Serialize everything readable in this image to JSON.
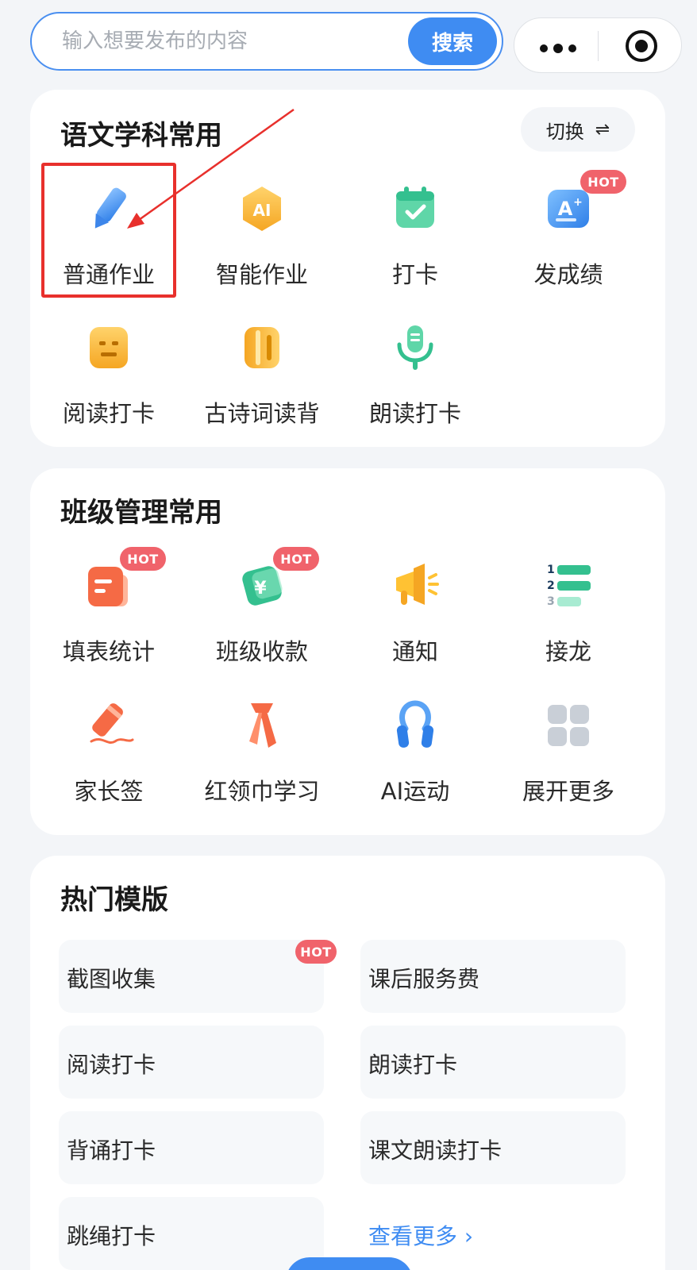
{
  "search": {
    "placeholder": "输入想要发布的内容",
    "button_label": "搜索"
  },
  "subject_section": {
    "title": "语文学科常用",
    "switch_label": "切换",
    "items": [
      {
        "label": "普通作业",
        "icon": "pencil-icon"
      },
      {
        "label": "智能作业",
        "icon": "ai-icon"
      },
      {
        "label": "打卡",
        "icon": "calendar-check-icon"
      },
      {
        "label": "发成绩",
        "icon": "grade-icon",
        "badge": "HOT"
      },
      {
        "label": "阅读打卡",
        "icon": "reading-icon"
      },
      {
        "label": "古诗词读背",
        "icon": "scroll-icon"
      },
      {
        "label": "朗读打卡",
        "icon": "microphone-icon"
      }
    ]
  },
  "class_section": {
    "title": "班级管理常用",
    "items": [
      {
        "label": "填表统计",
        "icon": "form-icon",
        "badge": "HOT"
      },
      {
        "label": "班级收款",
        "icon": "payment-icon",
        "badge": "HOT"
      },
      {
        "label": "通知",
        "icon": "megaphone-icon"
      },
      {
        "label": "接龙",
        "icon": "numbered-list-icon",
        "list_numbers": [
          "1",
          "2",
          "3"
        ]
      },
      {
        "label": "家长签",
        "icon": "signature-icon"
      },
      {
        "label": "红领巾学习",
        "icon": "red-scarf-icon"
      },
      {
        "label": "AI运动",
        "icon": "hand-grip-icon"
      },
      {
        "label": "展开更多",
        "icon": "grid-more-icon"
      }
    ]
  },
  "template_section": {
    "title": "热门模版",
    "items": [
      {
        "label": "截图收集",
        "badge": "HOT"
      },
      {
        "label": "课后服务费"
      },
      {
        "label": "阅读打卡"
      },
      {
        "label": "朗读打卡"
      },
      {
        "label": "背诵打卡"
      },
      {
        "label": "课文朗读打卡"
      },
      {
        "label": "跳绳打卡"
      }
    ],
    "see_more_label": "查看更多"
  },
  "colors": {
    "accent": "#3f8cf2",
    "hot_badge": "#f0636b",
    "annotation": "#e8302c",
    "background": "#f3f5f8"
  }
}
